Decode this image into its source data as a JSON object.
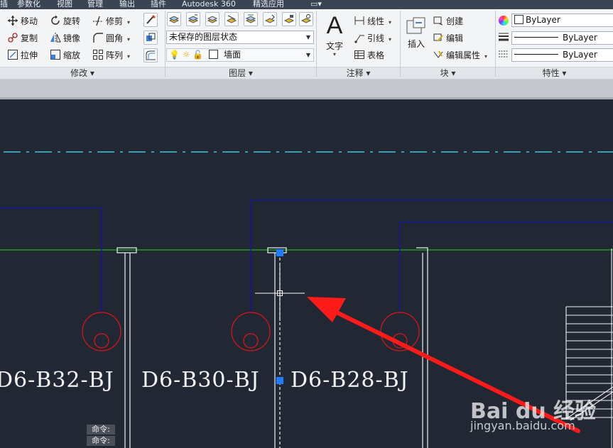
{
  "menu": {
    "items": [
      "插",
      "参数化",
      "视图",
      "管理",
      "输出",
      "插件",
      "Autodesk 360",
      "精选应用"
    ]
  },
  "modify": {
    "title": "修改",
    "tools": [
      "移动",
      "旋转",
      "修剪",
      "复制",
      "镜像",
      "圆角",
      "拉伸",
      "缩放",
      "阵列"
    ]
  },
  "layers": {
    "title": "图层",
    "state_value": "未保存的图层状态",
    "current_layer": "墙面"
  },
  "annotation": {
    "title": "注释",
    "text_label": "文字",
    "linear": "线性",
    "leader": "引线",
    "table": "表格"
  },
  "block": {
    "title": "块",
    "insert": "插入",
    "create": "创建",
    "edit": "编辑",
    "edit_attributes": "编辑属性"
  },
  "properties": {
    "title": "特性",
    "color": "ByLayer",
    "lineweight": "ByLayer",
    "linetype": "ByLayer"
  },
  "drawing": {
    "labels": [
      "D6-B32-BJ",
      "D6-B30-BJ",
      "D6-B28-BJ"
    ],
    "command_lines": [
      "命令:",
      "命令:"
    ]
  },
  "watermark": {
    "logo": "Bai du 经验",
    "url": "jingyan.baidu.com"
  },
  "colors": {
    "grip": "#1e7dff",
    "arrow": "#ff1a1a",
    "wire": "#1414a8",
    "green_line": "#22b322",
    "center_line": "#3fc7dd",
    "circle": "#e01414"
  }
}
